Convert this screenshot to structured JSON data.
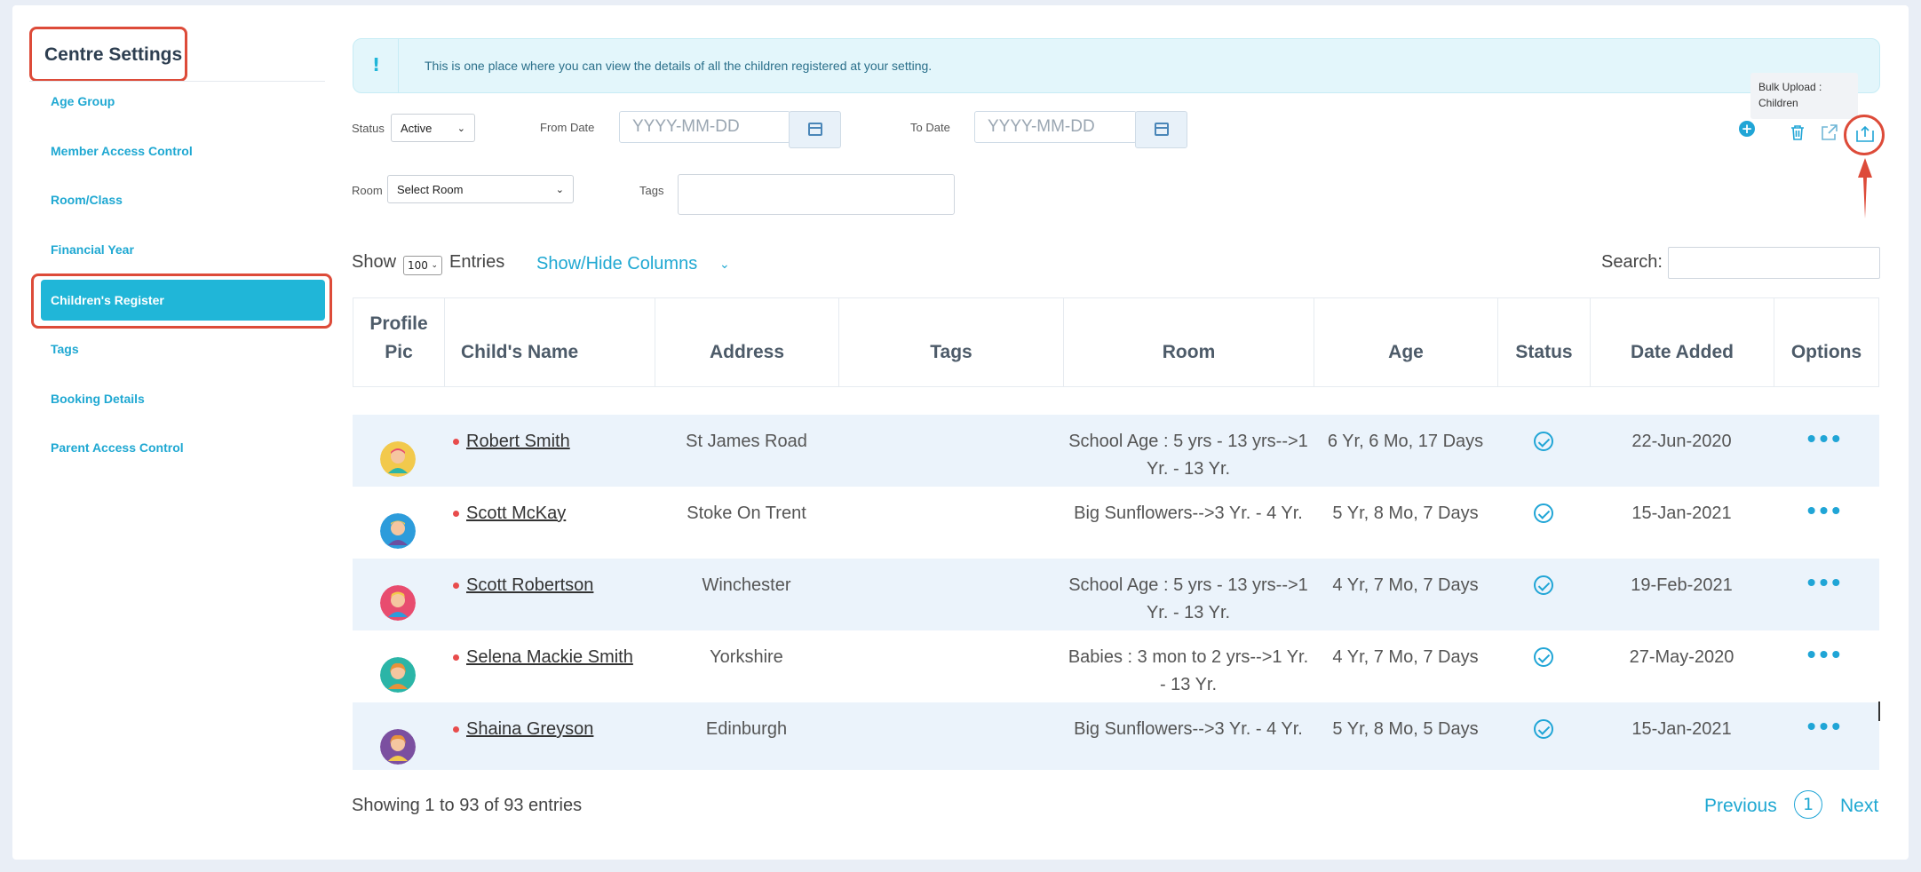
{
  "sidebar": {
    "title": "Centre Settings",
    "items": [
      {
        "label": "Age Group"
      },
      {
        "label": "Member Access Control"
      },
      {
        "label": "Room/Class"
      },
      {
        "label": "Financial Year"
      },
      {
        "label": "Children's Register",
        "active": true
      },
      {
        "label": "Tags"
      },
      {
        "label": "Booking Details"
      },
      {
        "label": "Parent Access Control"
      }
    ]
  },
  "notice": {
    "icon": "exclamation-icon",
    "text": "This is one place where you can view the details of all the children registered at your setting."
  },
  "filters": {
    "status_label": "Status",
    "status_value": "Active",
    "from_date_label": "From Date",
    "from_date_placeholder": "YYYY-MM-DD",
    "to_date_label": "To Date",
    "to_date_placeholder": "YYYY-MM-DD",
    "room_label": "Room",
    "room_value": "Select Room",
    "tags_label": "Tags"
  },
  "toolbar": {
    "tooltip_line1": "Bulk Upload :",
    "tooltip_line2": "Children",
    "icons": [
      "plus-circle-icon",
      "trash-icon",
      "share-icon",
      "upload-icon"
    ]
  },
  "table_controls": {
    "show_label": "Show",
    "entries_value": "100",
    "entries_label": "Entries",
    "show_hide_label": "Show/Hide Columns",
    "search_label": "Search:"
  },
  "table": {
    "headers": [
      "Profile Pic",
      "Child's Name",
      "Address",
      "Tags",
      "Room",
      "Age",
      "Status",
      "Date Added",
      "Options"
    ],
    "rows": [
      {
        "name": "Robert Smith",
        "address": "St James Road",
        "tags": "",
        "room": "School Age : 5 yrs - 13 yrs-->1 Yr. - 13 Yr.",
        "age": "6 Yr, 6 Mo, 17 Days",
        "date": "22-Jun-2020",
        "avatar_color": "#f2c94c"
      },
      {
        "name": "Scott McKay",
        "address": "Stoke On Trent",
        "tags": "",
        "room": "Big Sunflowers-->3 Yr. - 4 Yr.",
        "age": "5 Yr, 8 Mo, 7 Days",
        "date": "15-Jan-2021",
        "avatar_color": "#2d9cdb"
      },
      {
        "name": "Scott Robertson",
        "address": "Winchester",
        "tags": "",
        "room": "School Age : 5 yrs - 13 yrs-->1 Yr. - 13 Yr.",
        "age": "4 Yr, 7 Mo, 7 Days",
        "date": "19-Feb-2021",
        "avatar_color": "#e84c6f"
      },
      {
        "name": "Selena Mackie Smith",
        "address": "Yorkshire",
        "tags": "",
        "room": "Babies : 3 mon to 2 yrs-->1 Yr. - 13 Yr.",
        "age": "4 Yr, 7 Mo, 7 Days",
        "date": "27-May-2020",
        "avatar_color": "#2bb5a7"
      },
      {
        "name": "Shaina Greyson",
        "address": "Edinburgh",
        "tags": "",
        "room": "Big Sunflowers-->3 Yr. - 4 Yr.",
        "age": "5 Yr, 8 Mo, 5 Days",
        "date": "15-Jan-2021",
        "avatar_color": "#7b4fa0"
      }
    ]
  },
  "footer": {
    "showing": "Showing 1 to 93 of 93 entries",
    "previous": "Previous",
    "page": "1",
    "next": "Next"
  },
  "colors": {
    "accent": "#20b6d8",
    "highlight": "#dd4b39",
    "row_alt": "#ebf3fb"
  }
}
